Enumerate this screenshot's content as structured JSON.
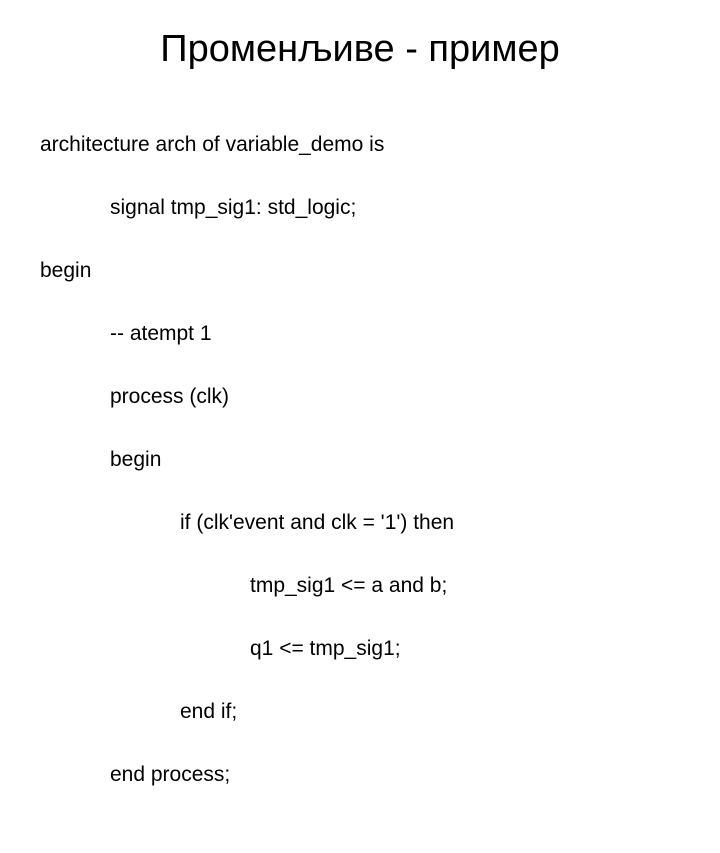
{
  "title": "Променљиве - пример",
  "code": {
    "l1": "architecture arch of variable_demo is",
    "l2": "signal tmp_sig1: std_logic;",
    "l3": "begin",
    "l4": "-- atempt 1",
    "l5": "process (clk)",
    "l6": "begin",
    "l7": "if (clk'event and clk = '1') then",
    "l8": "tmp_sig1 <= a and b;",
    "l9": "q1 <= tmp_sig1;",
    "l10": "end if;",
    "l11": "end process;"
  }
}
